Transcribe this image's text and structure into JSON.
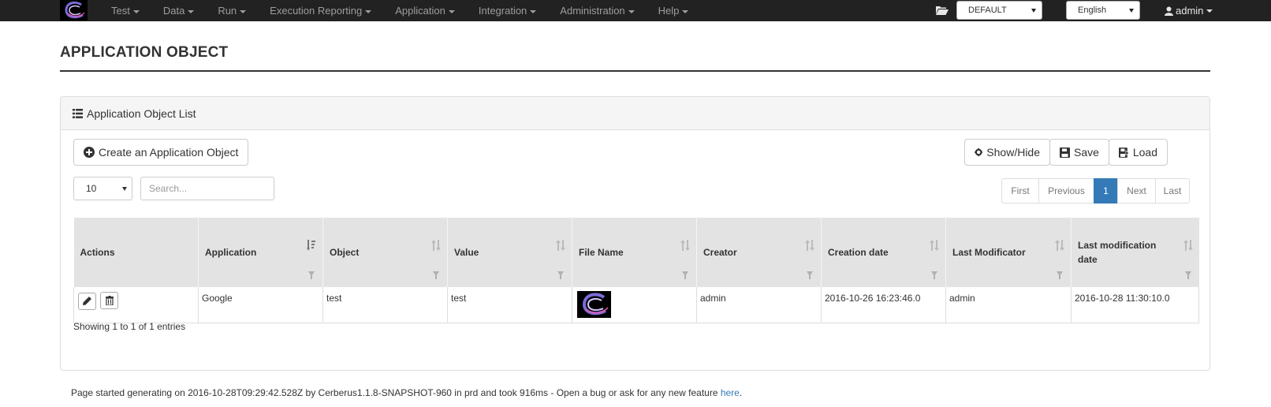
{
  "navbar": {
    "menu": [
      "Test",
      "Data",
      "Run",
      "Execution Reporting",
      "Application",
      "Integration",
      "Administration",
      "Help"
    ],
    "system_select": "DEFAULT",
    "language_select": "English",
    "user": "admin"
  },
  "page": {
    "title": "APPLICATION OBJECT"
  },
  "panel": {
    "heading": "Application Object List",
    "create_button": "Create an Application Object",
    "show_hide_button": "Show/Hide",
    "save_button": "Save",
    "load_button": "Load",
    "page_length": "10",
    "search_placeholder": "Search...",
    "pagination": [
      "First",
      "Previous",
      "1",
      "Next",
      "Last"
    ],
    "info": "Showing 1 to 1 of 1 entries"
  },
  "table": {
    "columns": [
      "Actions",
      "Application",
      "Object",
      "Value",
      "File Name",
      "Creator",
      "Creation date",
      "Last Modificator",
      "Last modification date"
    ],
    "rows": [
      {
        "application": "Google",
        "object": "test",
        "value": "test",
        "file_name_icon": "cerberus-logo-thumbnail",
        "creator": "admin",
        "creation_date": "2016-10-26 16:23:46.0",
        "last_modificator": "admin",
        "last_modification_date": "2016-10-28 11:30:10.0"
      }
    ]
  },
  "footer": {
    "text": "Page started generating on 2016-10-28T09:29:42.528Z by Cerberus1.1.8-SNAPSHOT-960 in prd and took 916ms - Open a bug or ask for any new feature ",
    "link": "here",
    "suffix": "."
  },
  "colors": {
    "navbar_bg": "#222222",
    "primary": "#337ab7",
    "table_header_bg": "#e3e3e3",
    "panel_heading_bg": "#f5f5f5"
  }
}
